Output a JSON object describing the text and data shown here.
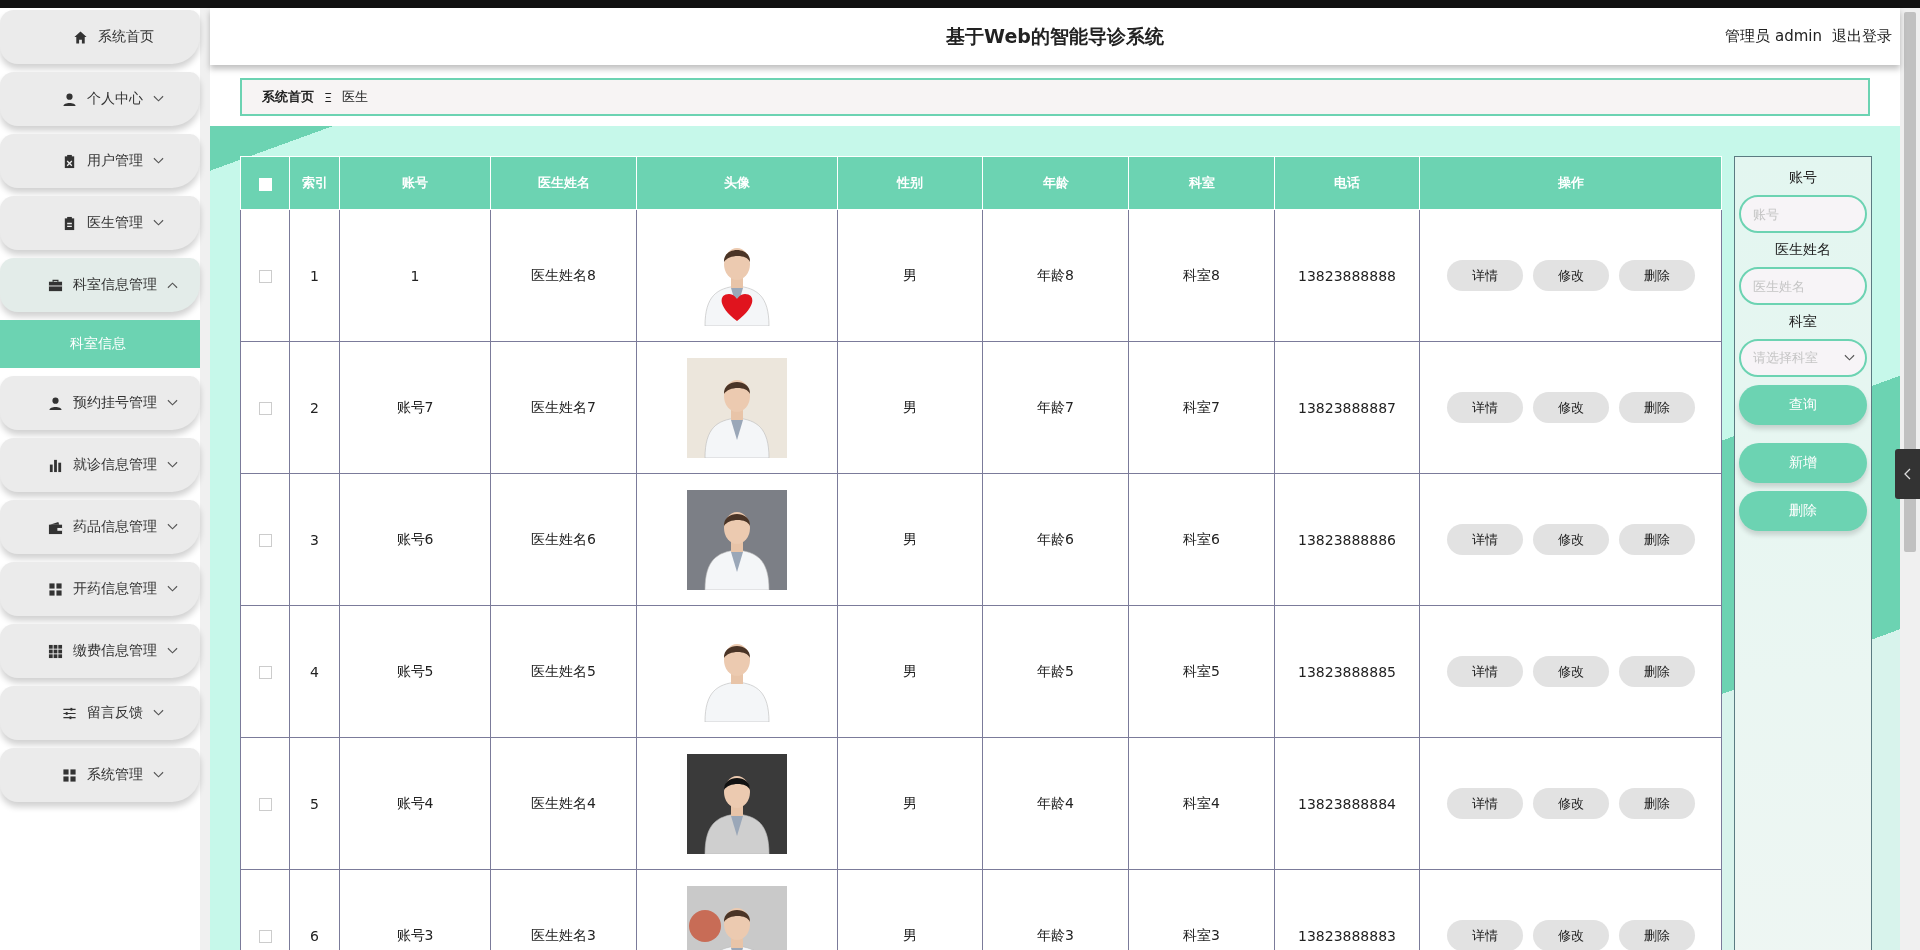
{
  "sidebar": {
    "items": [
      {
        "label": "系统首页",
        "kind": "home",
        "has_caret": false
      },
      {
        "label": "个人中心",
        "kind": "person",
        "expanded": false,
        "has_caret": true
      },
      {
        "label": "用户管理",
        "kind": "users",
        "expanded": false,
        "has_caret": true
      },
      {
        "label": "医生管理",
        "kind": "doctors",
        "expanded": false,
        "has_caret": true
      },
      {
        "label": "科室信息管理",
        "kind": "department",
        "expanded": true,
        "has_caret": true,
        "children": [
          {
            "label": "科室信息",
            "selected": true
          }
        ]
      },
      {
        "label": "预约挂号管理",
        "kind": "person",
        "expanded": false,
        "has_caret": true
      },
      {
        "label": "就诊信息管理",
        "kind": "stats",
        "expanded": false,
        "has_caret": true
      },
      {
        "label": "药品信息管理",
        "kind": "drugs",
        "expanded": false,
        "has_caret": true
      },
      {
        "label": "开药信息管理",
        "kind": "tiles",
        "expanded": false,
        "has_caret": true
      },
      {
        "label": "缴费信息管理",
        "kind": "payment",
        "expanded": false,
        "has_caret": true
      },
      {
        "label": "留言反馈",
        "kind": "feedback",
        "expanded": false,
        "has_caret": true
      },
      {
        "label": "系统管理",
        "kind": "tiles",
        "expanded": false,
        "has_caret": true
      }
    ]
  },
  "header": {
    "title": "基于Web的智能导诊系统",
    "user": "管理员 admin",
    "logout": "退出登录"
  },
  "breadcrumb": {
    "home": "系统首页",
    "separator": "Ξ",
    "current": "医生"
  },
  "table": {
    "select_all_checked": false,
    "columns": [
      "索引",
      "账号",
      "医生姓名",
      "头像",
      "性别",
      "年龄",
      "科室",
      "电话",
      "操作"
    ],
    "rows": [
      {
        "checked": false,
        "index": "1",
        "account": "1",
        "name": "医生姓名8",
        "gender": "男",
        "age": "年龄8",
        "dept": "科室8",
        "phone": "13823888888",
        "actions": [
          "详情",
          "修改",
          "删除"
        ]
      },
      {
        "checked": false,
        "index": "2",
        "account": "账号7",
        "name": "医生姓名7",
        "gender": "男",
        "age": "年龄7",
        "dept": "科室7",
        "phone": "13823888887",
        "actions": [
          "详情",
          "修改",
          "删除"
        ]
      },
      {
        "checked": false,
        "index": "3",
        "account": "账号6",
        "name": "医生姓名6",
        "gender": "男",
        "age": "年龄6",
        "dept": "科室6",
        "phone": "13823888886",
        "actions": [
          "详情",
          "修改",
          "删除"
        ]
      },
      {
        "checked": false,
        "index": "4",
        "account": "账号5",
        "name": "医生姓名5",
        "gender": "男",
        "age": "年龄5",
        "dept": "科室5",
        "phone": "13823888885",
        "actions": [
          "详情",
          "修改",
          "删除"
        ]
      },
      {
        "checked": false,
        "index": "5",
        "account": "账号4",
        "name": "医生姓名4",
        "gender": "男",
        "age": "年龄4",
        "dept": "科室4",
        "phone": "13823888884",
        "actions": [
          "详情",
          "修改",
          "删除"
        ]
      },
      {
        "checked": false,
        "index": "6",
        "account": "账号3",
        "name": "医生姓名3",
        "gender": "男",
        "age": "年龄3",
        "dept": "科室3",
        "phone": "13823888883",
        "actions": [
          "详情",
          "修改",
          "删除"
        ]
      }
    ]
  },
  "search_panel": {
    "fields": [
      {
        "kind": "input",
        "label": "账号",
        "placeholder": "账号"
      },
      {
        "kind": "input",
        "label": "医生姓名",
        "placeholder": "医生姓名"
      },
      {
        "kind": "select",
        "label": "科室",
        "placeholder": "请选择科室"
      }
    ],
    "buttons": [
      "查询",
      "新增",
      "删除"
    ]
  }
}
